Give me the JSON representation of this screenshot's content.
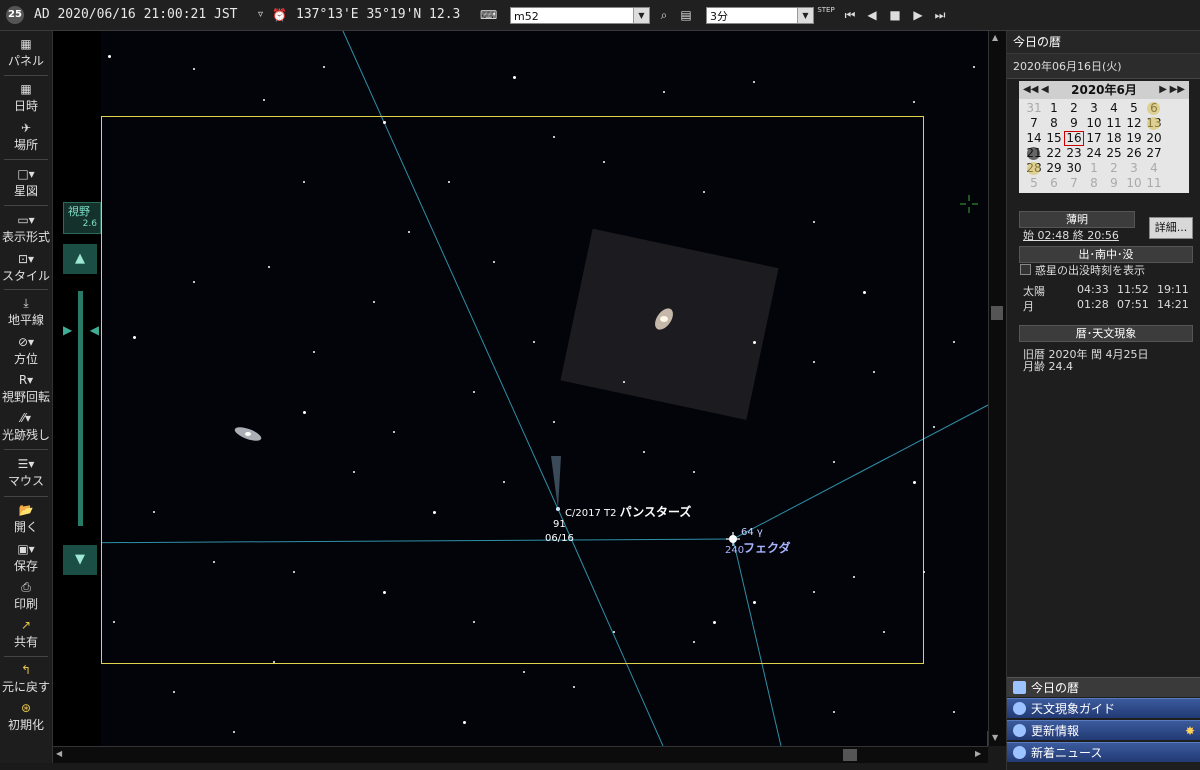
{
  "toolbar": {
    "logo": "25",
    "datetime": "AD 2020/06/16 21:00:21 JST",
    "tz_marker": "▿",
    "coords": "137°13'E 35°19'N 12.3",
    "search_value": "m52",
    "step_value": "3分",
    "step_label": "STEP"
  },
  "leftbar": {
    "panel": "パネル",
    "datetime": "日時",
    "place": "場所",
    "starmap": "星図",
    "display": "表示形式",
    "style": "スタイル",
    "horizon": "地平線",
    "direction": "方位",
    "rotate": "視野回転",
    "trail": "光跡残し",
    "mouse": "マウス",
    "open": "開く",
    "save": "保存",
    "print": "印刷",
    "share": "共有",
    "undo": "元に戻す",
    "reset": "初期化"
  },
  "fov": {
    "label": "視野",
    "value": "2.6"
  },
  "sky": {
    "comet_name": "C/2017 T2",
    "comet_name_jp": "パンスターズ",
    "comet_mag": "91",
    "comet_date": "06/16",
    "star_id": "64 γ",
    "star_name": "フェクダ",
    "star_num": "240"
  },
  "right": {
    "header": "今日の暦",
    "date": "2020年06月16日(火)",
    "cal_title": "2020年6月",
    "cal_rows": [
      [
        "31",
        "1",
        "2",
        "3",
        "4",
        "5",
        "6"
      ],
      [
        "7",
        "8",
        "9",
        "10",
        "11",
        "12",
        "13"
      ],
      [
        "14",
        "15",
        "16",
        "17",
        "18",
        "19",
        "20"
      ],
      [
        "21",
        "22",
        "23",
        "24",
        "25",
        "26",
        "27"
      ],
      [
        "28",
        "29",
        "30",
        "1",
        "2",
        "3",
        "4"
      ],
      [
        "5",
        "6",
        "7",
        "8",
        "9",
        "10",
        "11"
      ]
    ],
    "twilight_title": "薄明",
    "twilight": "始 02:48  終 20:56",
    "details_button": "詳細...",
    "rise_title": "出･南中･没",
    "planet_checkbox": "惑星の出没時刻を表示",
    "sun": {
      "name": "太陽",
      "rise": "04:33",
      "transit": "11:52",
      "set": "19:11"
    },
    "moon": {
      "name": "月",
      "rise": "01:28",
      "transit": "07:51",
      "set": "14:21"
    },
    "almanac_title": "暦･天文現象",
    "lunar_date": "旧暦 2020年 閏 4月25日",
    "moon_age": "月齢 24.4",
    "links": [
      "今日の暦",
      "天文現象ガイド",
      "更新情報",
      "新着ニュース"
    ]
  },
  "colors": {
    "accent": "#3b5a9c",
    "frame": "#e0d24a",
    "line": "#2f8fa8"
  }
}
